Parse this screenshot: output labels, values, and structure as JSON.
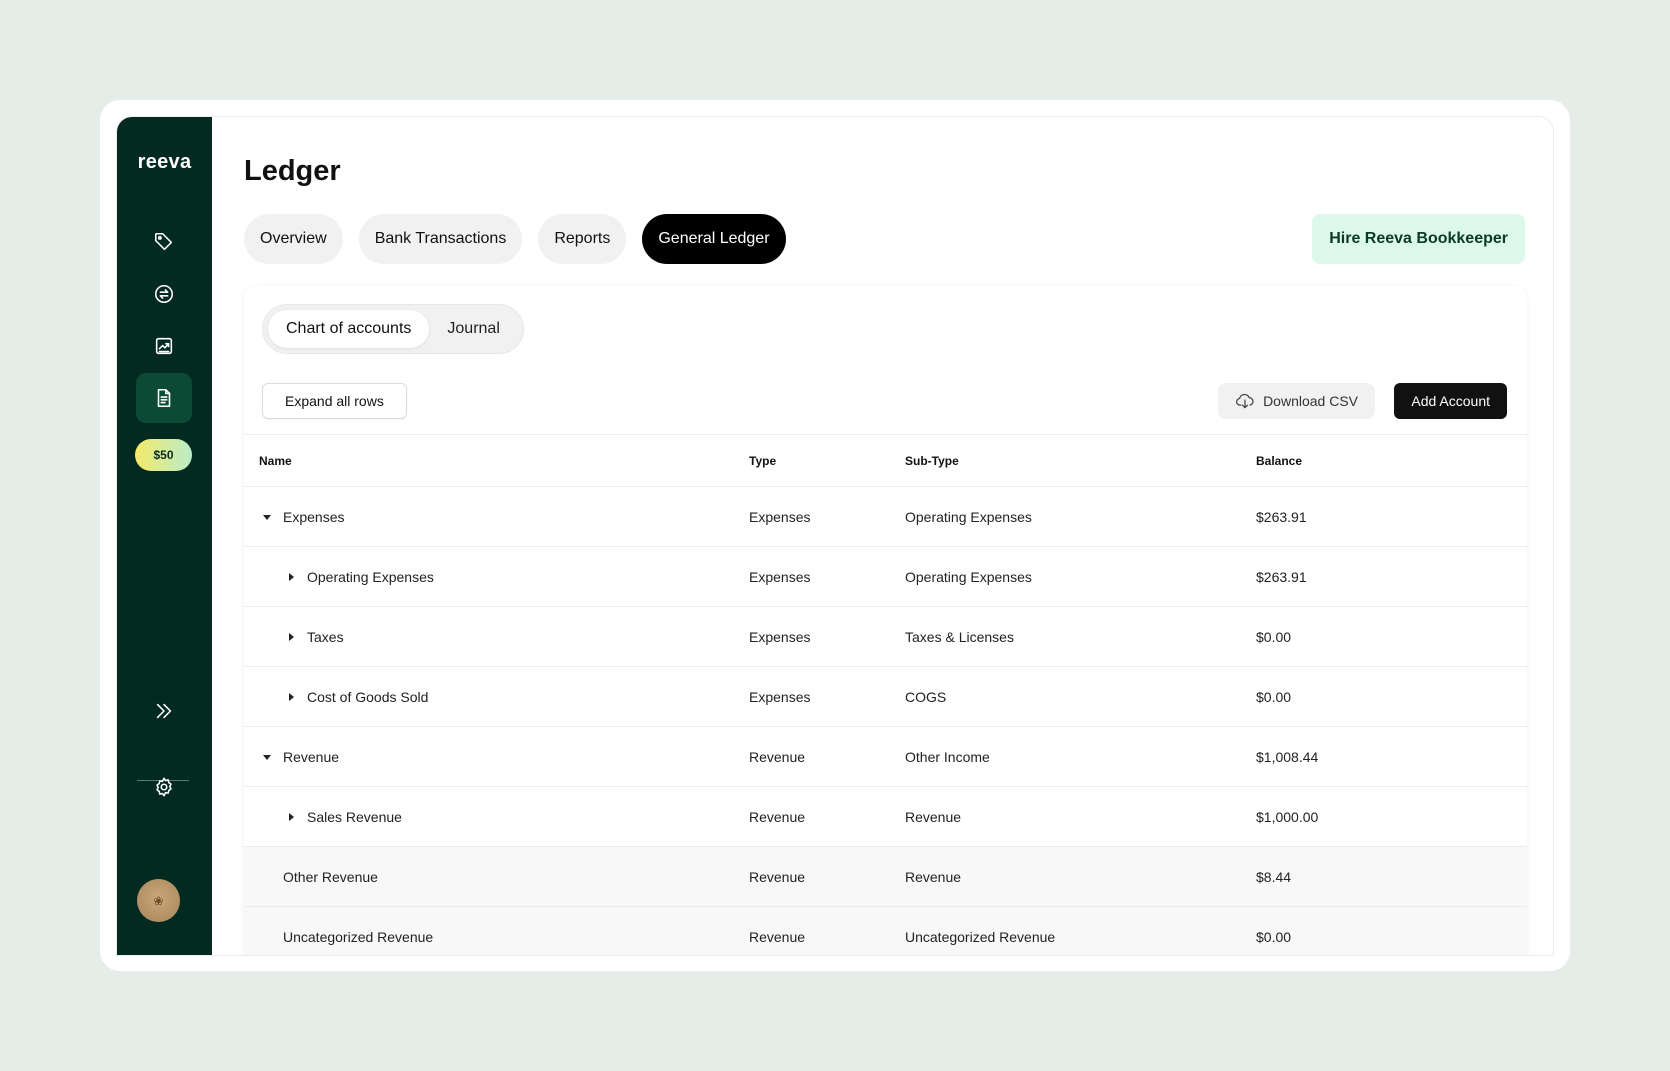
{
  "sidebar": {
    "logo": "reeva",
    "nav_icons": [
      "tag-icon",
      "refresh-icon",
      "chart-icon",
      "document-icon"
    ],
    "credit_badge": "$50",
    "expand_icon": "double-chevron-right-icon",
    "settings_icon": "gear-icon"
  },
  "page": {
    "title": "Ledger"
  },
  "tabs": [
    {
      "label": "Overview",
      "active": false
    },
    {
      "label": "Bank Transactions",
      "active": false
    },
    {
      "label": "Reports",
      "active": false
    },
    {
      "label": "General Ledger",
      "active": true
    }
  ],
  "hire_button": "Hire Reeva Bookkeeper",
  "subtabs": [
    {
      "label": "Chart of accounts",
      "active": true
    },
    {
      "label": "Journal",
      "active": false
    }
  ],
  "toolbar": {
    "expand_label": "Expand all rows",
    "download_label": "Download CSV",
    "add_label": "Add Account"
  },
  "table": {
    "headers": {
      "name": "Name",
      "type": "Type",
      "subtype": "Sub-Type",
      "balance": "Balance"
    },
    "rows": [
      {
        "name": "Expenses",
        "type": "Expenses",
        "subtype": "Operating Expenses",
        "balance": "$263.91",
        "caret": "expanded"
      },
      {
        "name": "Operating Expenses",
        "type": "Expenses",
        "subtype": "Operating Expenses",
        "balance": "$263.91",
        "caret": "collapsed"
      },
      {
        "name": "Taxes",
        "type": "Expenses",
        "subtype": "Taxes & Licenses",
        "balance": "$0.00",
        "caret": "collapsed"
      },
      {
        "name": "Cost of Goods Sold",
        "type": "Expenses",
        "subtype": "COGS",
        "balance": "$0.00",
        "caret": "collapsed"
      },
      {
        "name": "Revenue",
        "type": "Revenue",
        "subtype": "Other Income",
        "balance": "$1,008.44",
        "caret": "expanded"
      },
      {
        "name": "Sales Revenue",
        "type": "Revenue",
        "subtype": "Revenue",
        "balance": "$1,000.00",
        "caret": "collapsed"
      },
      {
        "name": "Other Revenue",
        "type": "Revenue",
        "subtype": "Revenue",
        "balance": "$8.44",
        "caret": "none"
      },
      {
        "name": "Uncategorized Revenue",
        "type": "Revenue",
        "subtype": "Uncategorized Revenue",
        "balance": "$0.00",
        "caret": "none"
      }
    ]
  }
}
